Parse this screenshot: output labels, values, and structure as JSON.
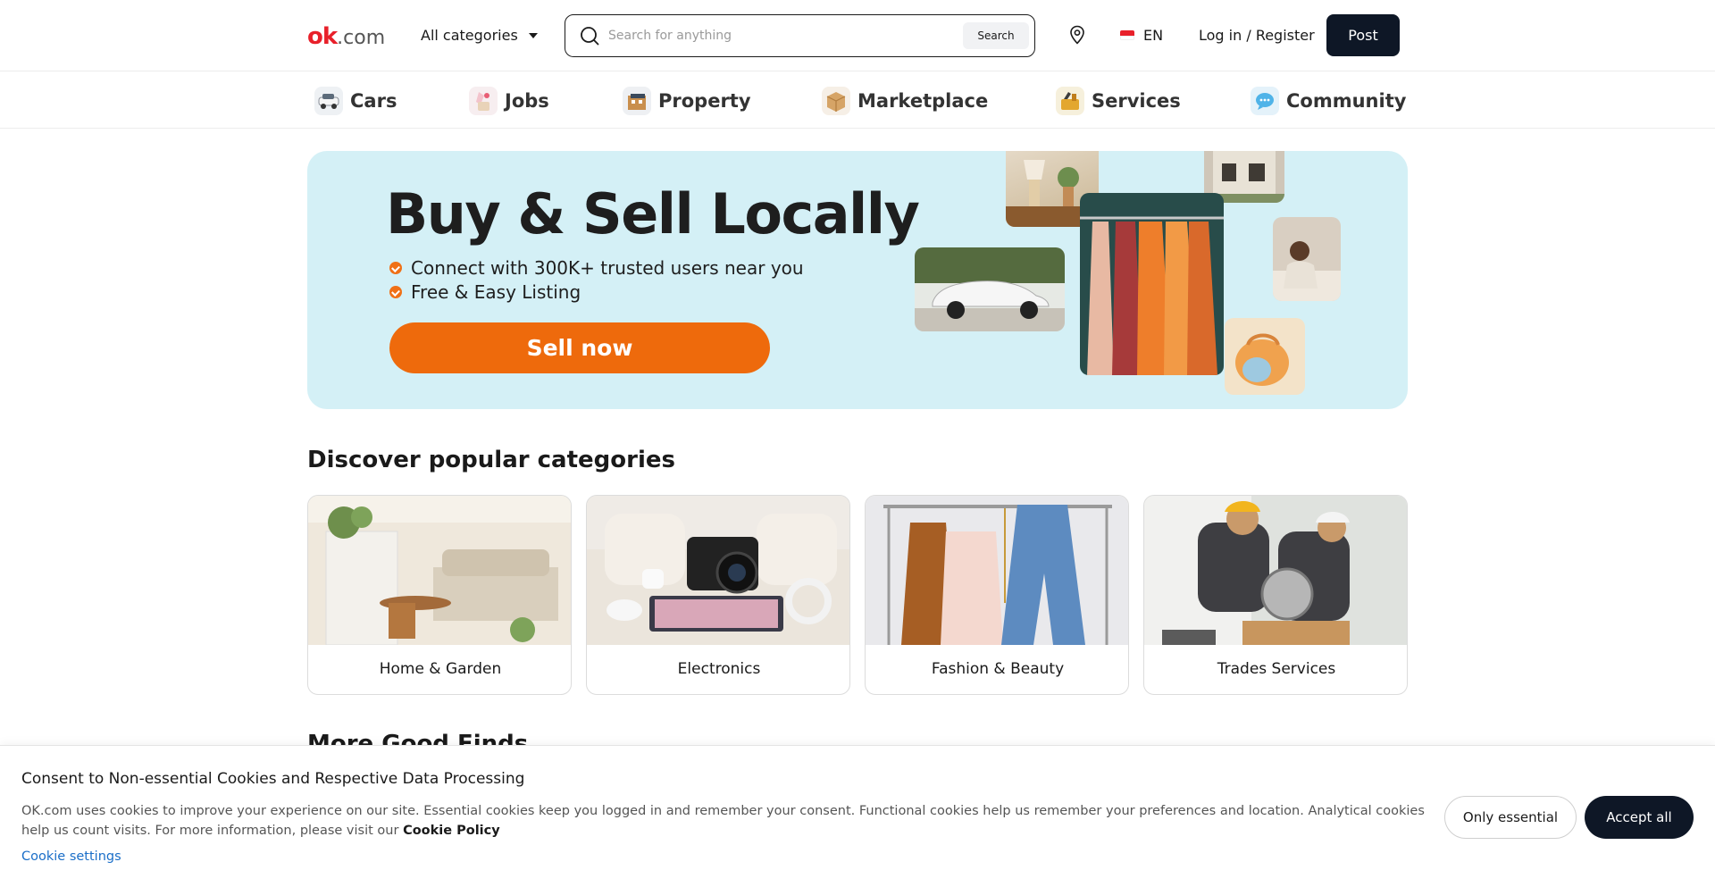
{
  "header": {
    "logo_mark": "ok",
    "logo_domain": ".com",
    "all_categories": "All categories",
    "search_placeholder": "Search for anything",
    "search_button": "Search",
    "language": "EN",
    "login": "Log in / Register",
    "post": "Post"
  },
  "nav": [
    {
      "label": "Cars",
      "icon": "car-icon"
    },
    {
      "label": "Jobs",
      "icon": "jobs-icon"
    },
    {
      "label": "Property",
      "icon": "property-icon"
    },
    {
      "label": "Marketplace",
      "icon": "box-icon"
    },
    {
      "label": "Services",
      "icon": "services-icon"
    },
    {
      "label": "Community",
      "icon": "chat-icon"
    }
  ],
  "banner": {
    "title": "Buy & Sell Locally",
    "bullet1": "Connect with 300K+ trusted users near you",
    "bullet2": "Free & Easy Listing",
    "cta": "Sell now"
  },
  "categories": {
    "title": "Discover popular categories",
    "items": [
      {
        "label": "Home & Garden"
      },
      {
        "label": "Electronics"
      },
      {
        "label": "Fashion & Beauty"
      },
      {
        "label": "Trades Services"
      }
    ]
  },
  "more": {
    "title": "More Good Finds"
  },
  "cookie": {
    "title": "Consent to Non-essential Cookies and Respective Data Processing",
    "text": "OK.com uses cookies to improve your experience on our site. Essential cookies keep you logged in and remember your consent. Functional cookies help us remember your preferences and location. Analytical cookies help us count visits. For more information, please visit our ",
    "policy_link": "Cookie Policy",
    "settings": "Cookie settings",
    "only_essential": "Only essential",
    "accept_all": "Accept all"
  },
  "colors": {
    "brand_red": "#e8202a",
    "accent_orange": "#ee6a0c",
    "dark_button": "#0e1726",
    "banner_bg": "#d4f0f6",
    "link_blue": "#1a6ec8"
  }
}
